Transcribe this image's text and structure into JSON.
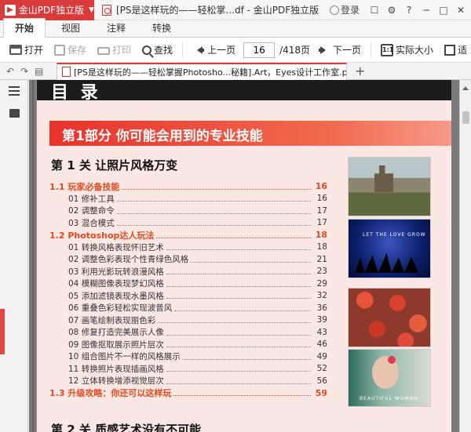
{
  "titlebar": {
    "app_name": "金山PDF独立版",
    "doc_title": "[PS是这样玩的——轻松掌...df - 金山PDF独立版",
    "login": "登录",
    "help": "?"
  },
  "menu": {
    "tabs": [
      "开始",
      "视图",
      "注释",
      "转换"
    ]
  },
  "toolbar": {
    "open": "打开",
    "save": "保存",
    "print": "打印",
    "find": "查找",
    "prev_page": "上一页",
    "page_current": "16",
    "page_total": "/418页",
    "next_page": "下一页",
    "actual_size": "实际大小",
    "fit": "适"
  },
  "tabrow": {
    "doc_tab": "[PS是这样玩的——轻松掌握Photosho...秘籍].Art，Eyes设计工作室.pdf",
    "close": "×",
    "new_tab": "+"
  },
  "page": {
    "heading": "目 录",
    "part_title": "第1部分  你可能会用到的专业技能",
    "chapter1": "第 1 关  让照片风格万变",
    "chapter2": "第 2 关  质感艺术没有不可能",
    "toc": [
      {
        "type": "section",
        "title": "1.1  玩家必备技能",
        "page": "16"
      },
      {
        "type": "item",
        "title": "01  修补工具",
        "page": "16"
      },
      {
        "type": "item",
        "title": "02  调整命令",
        "page": "17"
      },
      {
        "type": "item",
        "title": "03  混合模式",
        "page": "17"
      },
      {
        "type": "section",
        "title": "1.2  Photoshop达人玩法",
        "page": "18"
      },
      {
        "type": "item",
        "title": "01  转换风格表现怀旧艺术",
        "page": "18"
      },
      {
        "type": "item",
        "title": "02  调整色彩表现个性青绿色风格",
        "page": "21"
      },
      {
        "type": "item",
        "title": "03  利用光影玩转浪漫风格",
        "page": "23"
      },
      {
        "type": "item",
        "title": "04  模糊图像表现梦幻风格",
        "page": "29"
      },
      {
        "type": "item",
        "title": "05  添加滤镜表现水墨风格",
        "page": "32"
      },
      {
        "type": "item",
        "title": "06  重叠色彩轻松实现波普风",
        "page": "36"
      },
      {
        "type": "item",
        "title": "07  画笔绘制表现丽色彩",
        "page": "39"
      },
      {
        "type": "item",
        "title": "08  修复打造完美展示人像",
        "page": "43"
      },
      {
        "type": "item",
        "title": "09  图像抠取展示照片层次",
        "page": "46"
      },
      {
        "type": "item",
        "title": "10  组合图片不一样的风格展示",
        "page": "49"
      },
      {
        "type": "item",
        "title": "11  转换照片表现插画风格",
        "page": "52"
      },
      {
        "type": "item",
        "title": "12  立体转换增添视觉层次",
        "page": "56"
      },
      {
        "type": "section",
        "title": "1.3  升级攻略：你还可以这样玩",
        "page": "59"
      }
    ],
    "thumb_night_caption": "LET THE LOVE GROW",
    "thumb_portrait_caption": "BEAUTIFUL WOMAN"
  }
}
